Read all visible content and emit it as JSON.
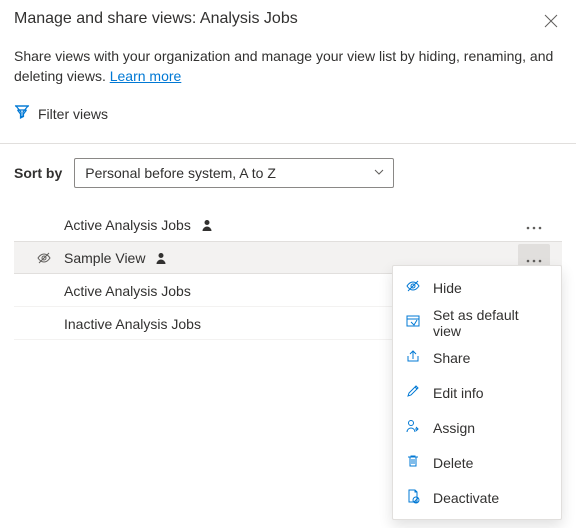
{
  "header": {
    "title": "Manage and share views: Analysis Jobs",
    "description": "Share views with your organization and manage your view list by hiding, renaming, and deleting views. ",
    "learn_more": "Learn more"
  },
  "filter": {
    "label": "Filter views"
  },
  "sort": {
    "label": "Sort by",
    "value": "Personal before system, A to Z"
  },
  "views": [
    {
      "name": "Active Analysis Jobs",
      "personal": true,
      "hidden": false,
      "selected": false,
      "has_more": true
    },
    {
      "name": "Sample View",
      "personal": true,
      "hidden": true,
      "selected": true,
      "has_more": true
    },
    {
      "name": "Active Analysis Jobs",
      "personal": false,
      "hidden": false,
      "selected": false,
      "has_more": false
    },
    {
      "name": "Inactive Analysis Jobs",
      "personal": false,
      "hidden": false,
      "selected": false,
      "has_more": false
    }
  ],
  "menu": {
    "hide": "Hide",
    "set_default": "Set as default view",
    "share": "Share",
    "edit": "Edit info",
    "assign": "Assign",
    "delete": "Delete",
    "deactivate": "Deactivate"
  }
}
